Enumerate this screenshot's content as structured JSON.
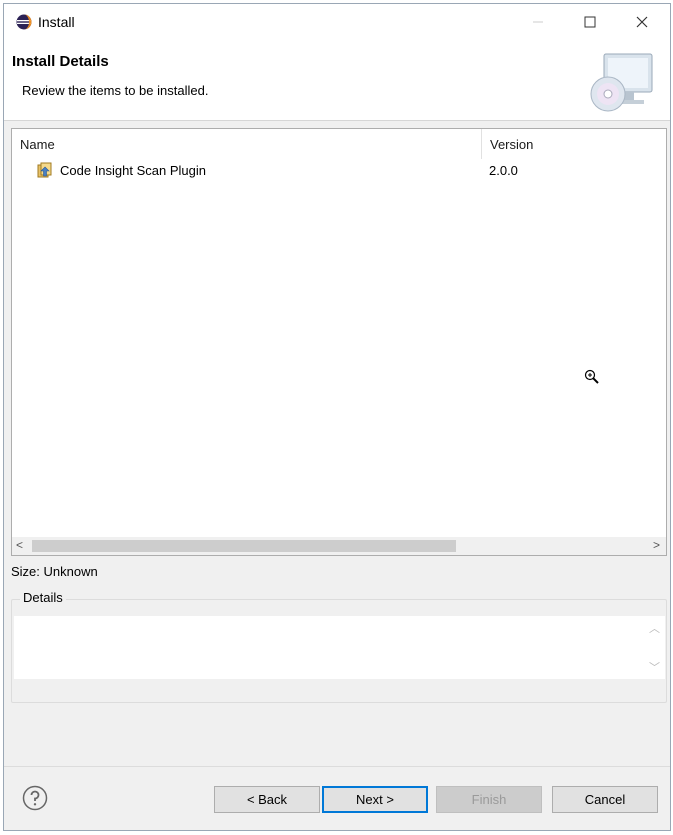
{
  "window": {
    "title": "Install",
    "minimize_label": "—",
    "maximize_label": "☐",
    "close_label": "✕"
  },
  "header": {
    "title": "Install Details",
    "description": "Review the items to be installed."
  },
  "table": {
    "columns": [
      "Name",
      "Version"
    ],
    "rows": [
      {
        "name": "Code Insight Scan Plugin",
        "version": "2.0.0",
        "icon": "plugin-install-icon"
      }
    ],
    "scroll_left": "<",
    "scroll_right": ">"
  },
  "size_label": "Size: Unknown",
  "details": {
    "legend": "Details",
    "text": "",
    "scroll_up": "︿",
    "scroll_down": "﹀"
  },
  "footer": {
    "back_label": "< Back",
    "next_label": "Next >",
    "finish_label": "Finish",
    "cancel_label": "Cancel"
  },
  "colors": {
    "accent": "#0078d7",
    "background": "#f0f0f0"
  }
}
